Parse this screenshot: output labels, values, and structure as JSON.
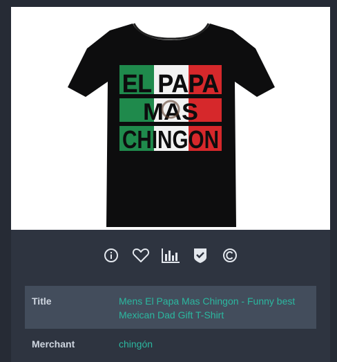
{
  "product": {
    "image_alt": "Black t-shirt with Mexican flag text EL PAPA MAS CHINGON",
    "shirt_text_lines": [
      "EL PAPA",
      "MAS",
      "CHINGON"
    ],
    "flag_colors": {
      "green": "#1f8a4c",
      "white": "#f2f2f2",
      "red": "#d6282b"
    }
  },
  "toolbar": {
    "icons": [
      "info-icon",
      "heart-icon",
      "bar-chart-icon",
      "shield-check-icon",
      "copyright-icon"
    ]
  },
  "details": {
    "rows": [
      {
        "label": "Title",
        "value": "Mens El Papa Mas Chingon - Funny best Mexican Dad Gift T-Shirt"
      },
      {
        "label": "Merchant",
        "value": "chingón"
      }
    ]
  }
}
